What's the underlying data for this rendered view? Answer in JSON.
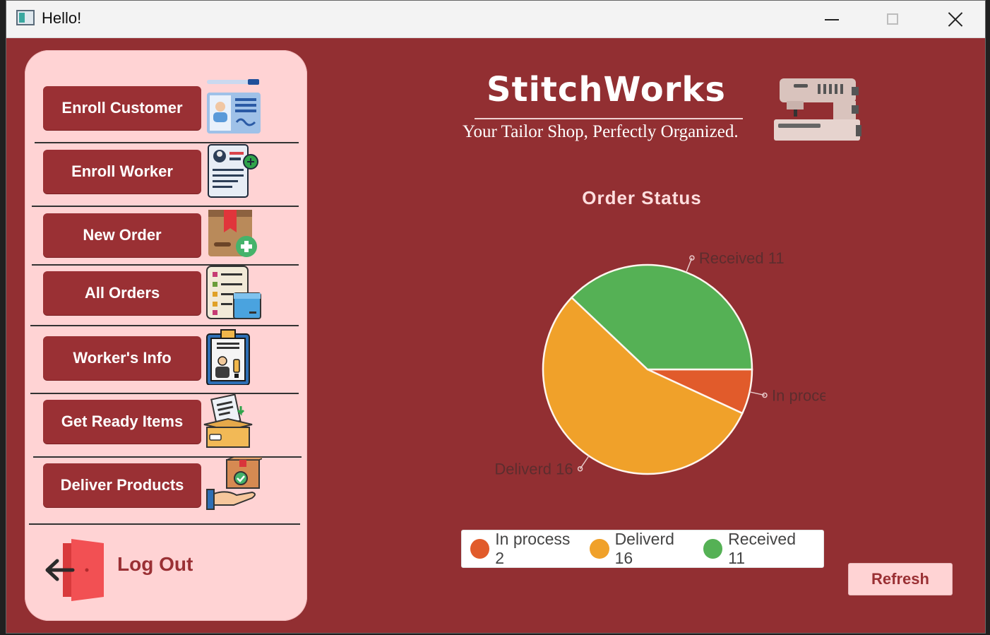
{
  "window": {
    "title": "Hello!"
  },
  "sidebar": {
    "items": [
      {
        "label": "Enroll Customer",
        "icon": "customer-id-card-icon"
      },
      {
        "label": "Enroll Worker",
        "icon": "worker-resume-icon"
      },
      {
        "label": "New Order",
        "icon": "new-order-box-icon"
      },
      {
        "label": "All Orders",
        "icon": "orders-list-icon"
      },
      {
        "label": "Worker's Info",
        "icon": "worker-clipboard-icon"
      },
      {
        "label": "Get Ready Items",
        "icon": "ready-items-box-icon"
      },
      {
        "label": "Deliver Products",
        "icon": "deliver-hand-box-icon"
      }
    ],
    "logout": {
      "label": "Log Out",
      "icon": "logout-door-icon"
    }
  },
  "brand": {
    "title": "StitchWorks",
    "subtitle": "Your Tailor Shop, Perfectly Organized.",
    "icon": "sewing-machine-icon"
  },
  "chart_data": {
    "type": "pie",
    "title": "Order Status",
    "labels": [
      "In process 2",
      "Deliverd 16",
      "Received 11"
    ],
    "categories": [
      "In process",
      "Deliverd",
      "Received"
    ],
    "values": [
      2,
      16,
      11
    ],
    "colors": [
      "#e15b2b",
      "#f0a12a",
      "#55b155"
    ],
    "legend": "bottom"
  },
  "actions": {
    "refresh_label": "Refresh"
  }
}
